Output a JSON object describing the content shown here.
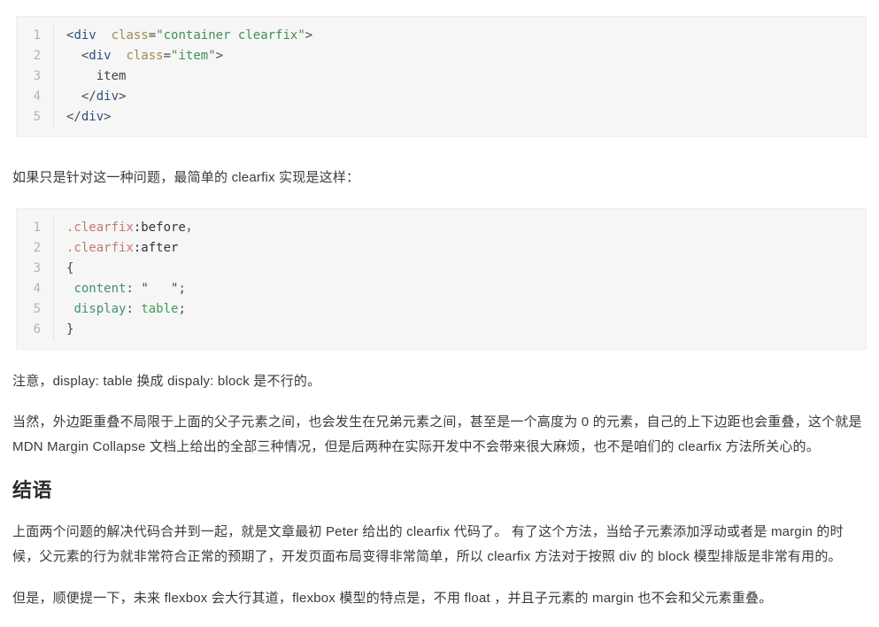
{
  "document": {
    "blocks": [
      {
        "kind": "code",
        "name": "html-code-block",
        "language": "html",
        "lines": [
          {
            "number": "1",
            "tokens": [
              {
                "t": "punct",
                "s": "<"
              },
              {
                "t": "tag",
                "s": "div"
              },
              {
                "t": "text",
                "s": "  "
              },
              {
                "t": "attr",
                "s": "class"
              },
              {
                "t": "punct",
                "s": "="
              },
              {
                "t": "string",
                "s": "\"container clearfix\""
              },
              {
                "t": "punct",
                "s": ">"
              }
            ]
          },
          {
            "number": "2",
            "tokens": [
              {
                "t": "text",
                "s": "  "
              },
              {
                "t": "punct",
                "s": "<"
              },
              {
                "t": "tag",
                "s": "div"
              },
              {
                "t": "text",
                "s": "  "
              },
              {
                "t": "attr",
                "s": "class"
              },
              {
                "t": "punct",
                "s": "="
              },
              {
                "t": "string",
                "s": "\"item\""
              },
              {
                "t": "punct",
                "s": ">"
              }
            ]
          },
          {
            "number": "3",
            "tokens": [
              {
                "t": "text",
                "s": "    item"
              }
            ]
          },
          {
            "number": "4",
            "tokens": [
              {
                "t": "text",
                "s": "  "
              },
              {
                "t": "punct",
                "s": "</"
              },
              {
                "t": "tag",
                "s": "div"
              },
              {
                "t": "punct",
                "s": ">"
              }
            ]
          },
          {
            "number": "5",
            "tokens": [
              {
                "t": "punct",
                "s": "</"
              },
              {
                "t": "tag",
                "s": "div"
              },
              {
                "t": "punct",
                "s": ">"
              }
            ]
          }
        ]
      },
      {
        "kind": "paragraph",
        "name": "paragraph-intro-clearfix",
        "text": "如果只是针对这一种问题，最简单的 clearfix 实现是这样："
      },
      {
        "kind": "code",
        "name": "css-code-block",
        "language": "css",
        "lines": [
          {
            "number": "1",
            "tokens": [
              {
                "t": "selector",
                "s": ".clearfix"
              },
              {
                "t": "pseudo",
                "s": ":before"
              },
              {
                "t": "punct",
                "s": "，"
              }
            ]
          },
          {
            "number": "2",
            "tokens": [
              {
                "t": "selector",
                "s": ".clearfix"
              },
              {
                "t": "pseudo",
                "s": ":after"
              }
            ]
          },
          {
            "number": "3",
            "tokens": [
              {
                "t": "brace",
                "s": "{"
              }
            ]
          },
          {
            "number": "4",
            "tokens": [
              {
                "t": "text",
                "s": " "
              },
              {
                "t": "prop",
                "s": "content"
              },
              {
                "t": "punct",
                "s": ": "
              },
              {
                "t": "brace",
                "s": "\"   \";"
              }
            ]
          },
          {
            "number": "5",
            "tokens": [
              {
                "t": "text",
                "s": " "
              },
              {
                "t": "prop",
                "s": "display"
              },
              {
                "t": "punct",
                "s": ": "
              },
              {
                "t": "value",
                "s": "table"
              },
              {
                "t": "punct",
                "s": ";"
              }
            ]
          },
          {
            "number": "6",
            "tokens": [
              {
                "t": "brace",
                "s": "}"
              }
            ]
          }
        ]
      },
      {
        "kind": "paragraph",
        "name": "paragraph-note-display-table",
        "text": "注意，display: table 换成 dispaly: block 是不行的。"
      },
      {
        "kind": "paragraph",
        "name": "paragraph-margin-collapse",
        "text": "当然，外边距重叠不局限于上面的父子元素之间，也会发生在兄弟元素之间，甚至是一个高度为 0 的元素，自己的上下边距也会重叠，这个就是 MDN Margin Collapse 文档上给出的全部三种情况，但是后两种在实际开发中不会带来很大麻烦，也不是咱们的 clearfix 方法所关心的。"
      },
      {
        "kind": "heading",
        "name": "section-heading-conclusion",
        "text": "结语"
      },
      {
        "kind": "paragraph",
        "name": "paragraph-conclusion-summary",
        "text": "上面两个问题的解决代码合并到一起，就是文章最初 Peter 给出的 clearfix 代码了。 有了这个方法，当给子元素添加浮动或者是 margin 的时候，父元素的行为就非常符合正常的预期了，开发页面布局变得非常简单，所以 clearfix 方法对于按照 div 的 block 模型排版是非常有用的。"
      },
      {
        "kind": "paragraph",
        "name": "paragraph-flexbox-note",
        "text": "但是，顺便提一下，未来 flexbox 会大行其道，flexbox 模型的特点是，不用 float ，并且子元素的 margin 也不会和父元素重叠。"
      }
    ]
  },
  "theme": {
    "page_background": "#ffffff",
    "code_background": "#f6f6f6",
    "code_border": "#eeeeee",
    "line_number_color": "#b4b4b4",
    "body_text_color": "#3a3a3a",
    "heading_color": "#2b2b2b",
    "token_tag": "#2f4f7f",
    "token_attribute": "#9a8c4e",
    "token_string": "#3f8f54",
    "token_selector": "#c07a6e",
    "token_property": "#3f8f7f",
    "token_value": "#3f9f54"
  }
}
